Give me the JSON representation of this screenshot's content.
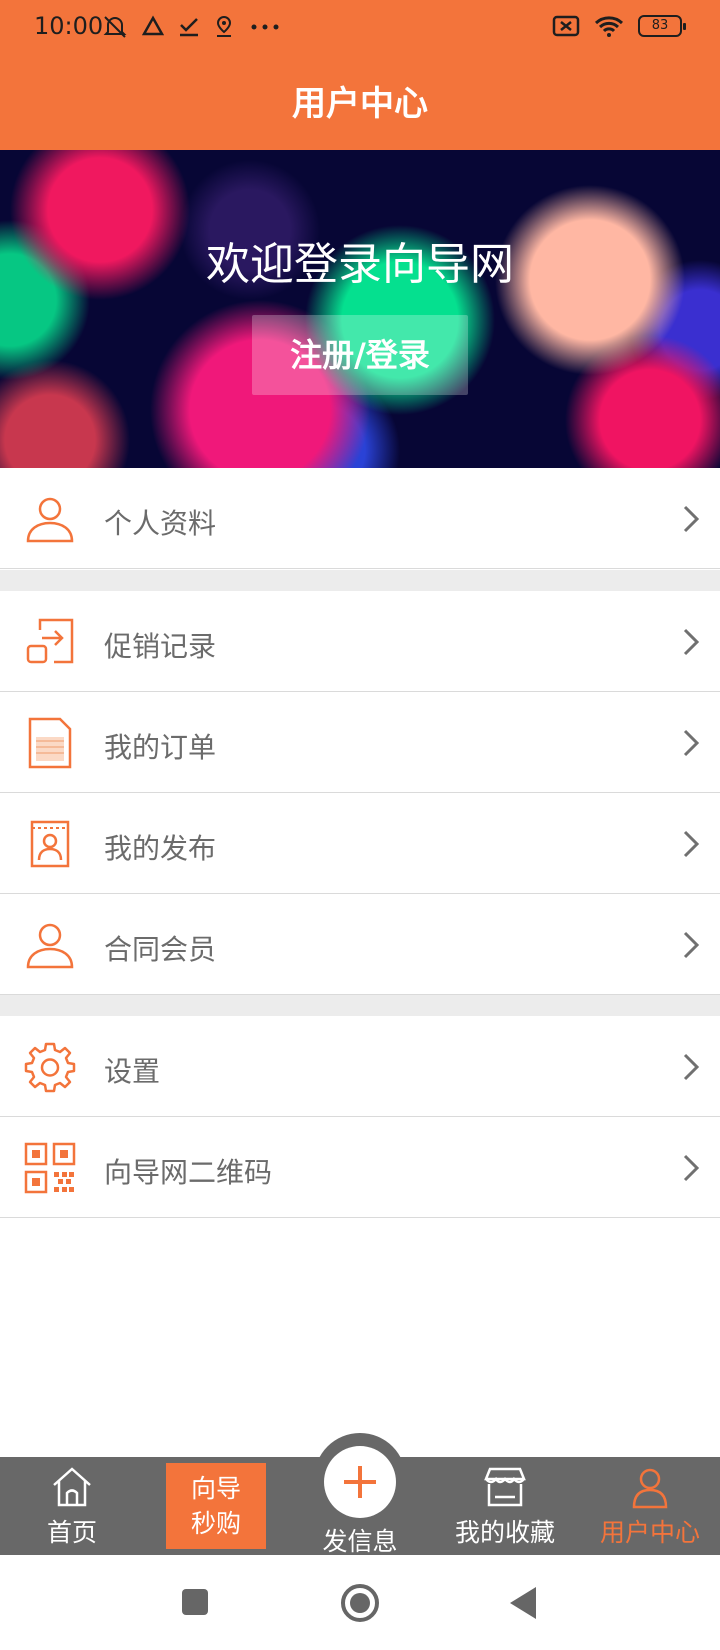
{
  "status_bar": {
    "time": "10:00",
    "battery": "83"
  },
  "header": {
    "title": "用户中心"
  },
  "banner": {
    "title": "欢迎登录向导网",
    "button": "注册/登录"
  },
  "menu": {
    "group1": [
      {
        "label": "个人资料",
        "icon": "person-icon"
      }
    ],
    "group2": [
      {
        "label": "促销记录",
        "icon": "export-icon"
      },
      {
        "label": "我的订单",
        "icon": "document-icon"
      },
      {
        "label": "我的发布",
        "icon": "id-card-icon"
      },
      {
        "label": "合同会员",
        "icon": "person-icon"
      }
    ],
    "group3": [
      {
        "label": "设置",
        "icon": "gear-icon"
      },
      {
        "label": "向导网二维码",
        "icon": "qr-code-icon"
      }
    ]
  },
  "tab_bar": {
    "home": "首页",
    "seckill_line1": "向导",
    "seckill_line2": "秒购",
    "publish": "发信息",
    "favorites": "我的收藏",
    "user_center": "用户中心",
    "active": "用户中心"
  },
  "colors": {
    "brand": "#f3743b",
    "tab_bar": "#686868",
    "label": "#6b6b6b",
    "divider": "#dadada"
  }
}
